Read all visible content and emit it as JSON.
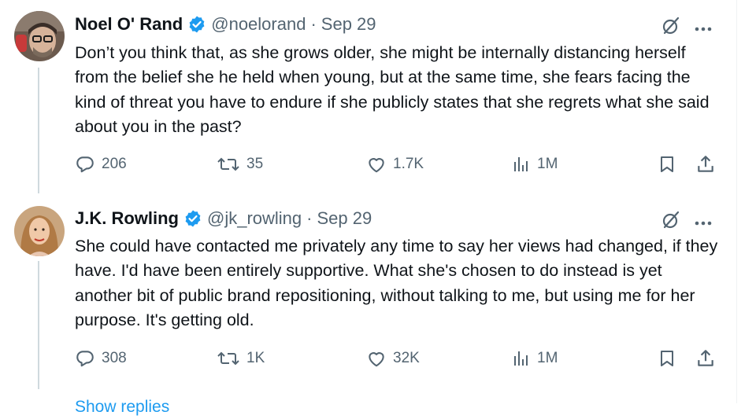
{
  "colors": {
    "text": "#0f1419",
    "muted": "#536471",
    "verified": "#1d9bf0",
    "thread_line": "#cfd9de"
  },
  "tweets": [
    {
      "author_name": "Noel O' Rand",
      "handle": "@noelorand",
      "separator": "·",
      "date": "Sep 29",
      "text": "Don’t you think that, as she grows older, she might be internally distancing herself from the belief she he held when young, but at the same time, she fears facing the kind of threat you have to endure if she publicly states that she regrets what she said about you in the past?",
      "replies": "206",
      "reposts": "35",
      "likes": "1.7K",
      "views": "1M",
      "icons": {
        "verified": "verified-badge-icon",
        "grok": "grok-icon",
        "more": "more-icon"
      }
    },
    {
      "author_name": "J.K. Rowling",
      "handle": "@jk_rowling",
      "separator": "·",
      "date": "Sep 29",
      "text": "She could have contacted me privately any time to say her views had changed, if they have. I'd have been entirely supportive. What she's chosen to do instead is yet another bit of public brand repositioning, without talking to me, but using me for her purpose. It's getting old.",
      "replies": "308",
      "reposts": "1K",
      "likes": "32K",
      "views": "1M",
      "icons": {
        "verified": "verified-badge-icon",
        "grok": "grok-icon",
        "more": "more-icon"
      }
    }
  ],
  "show_replies_label": "Show replies"
}
